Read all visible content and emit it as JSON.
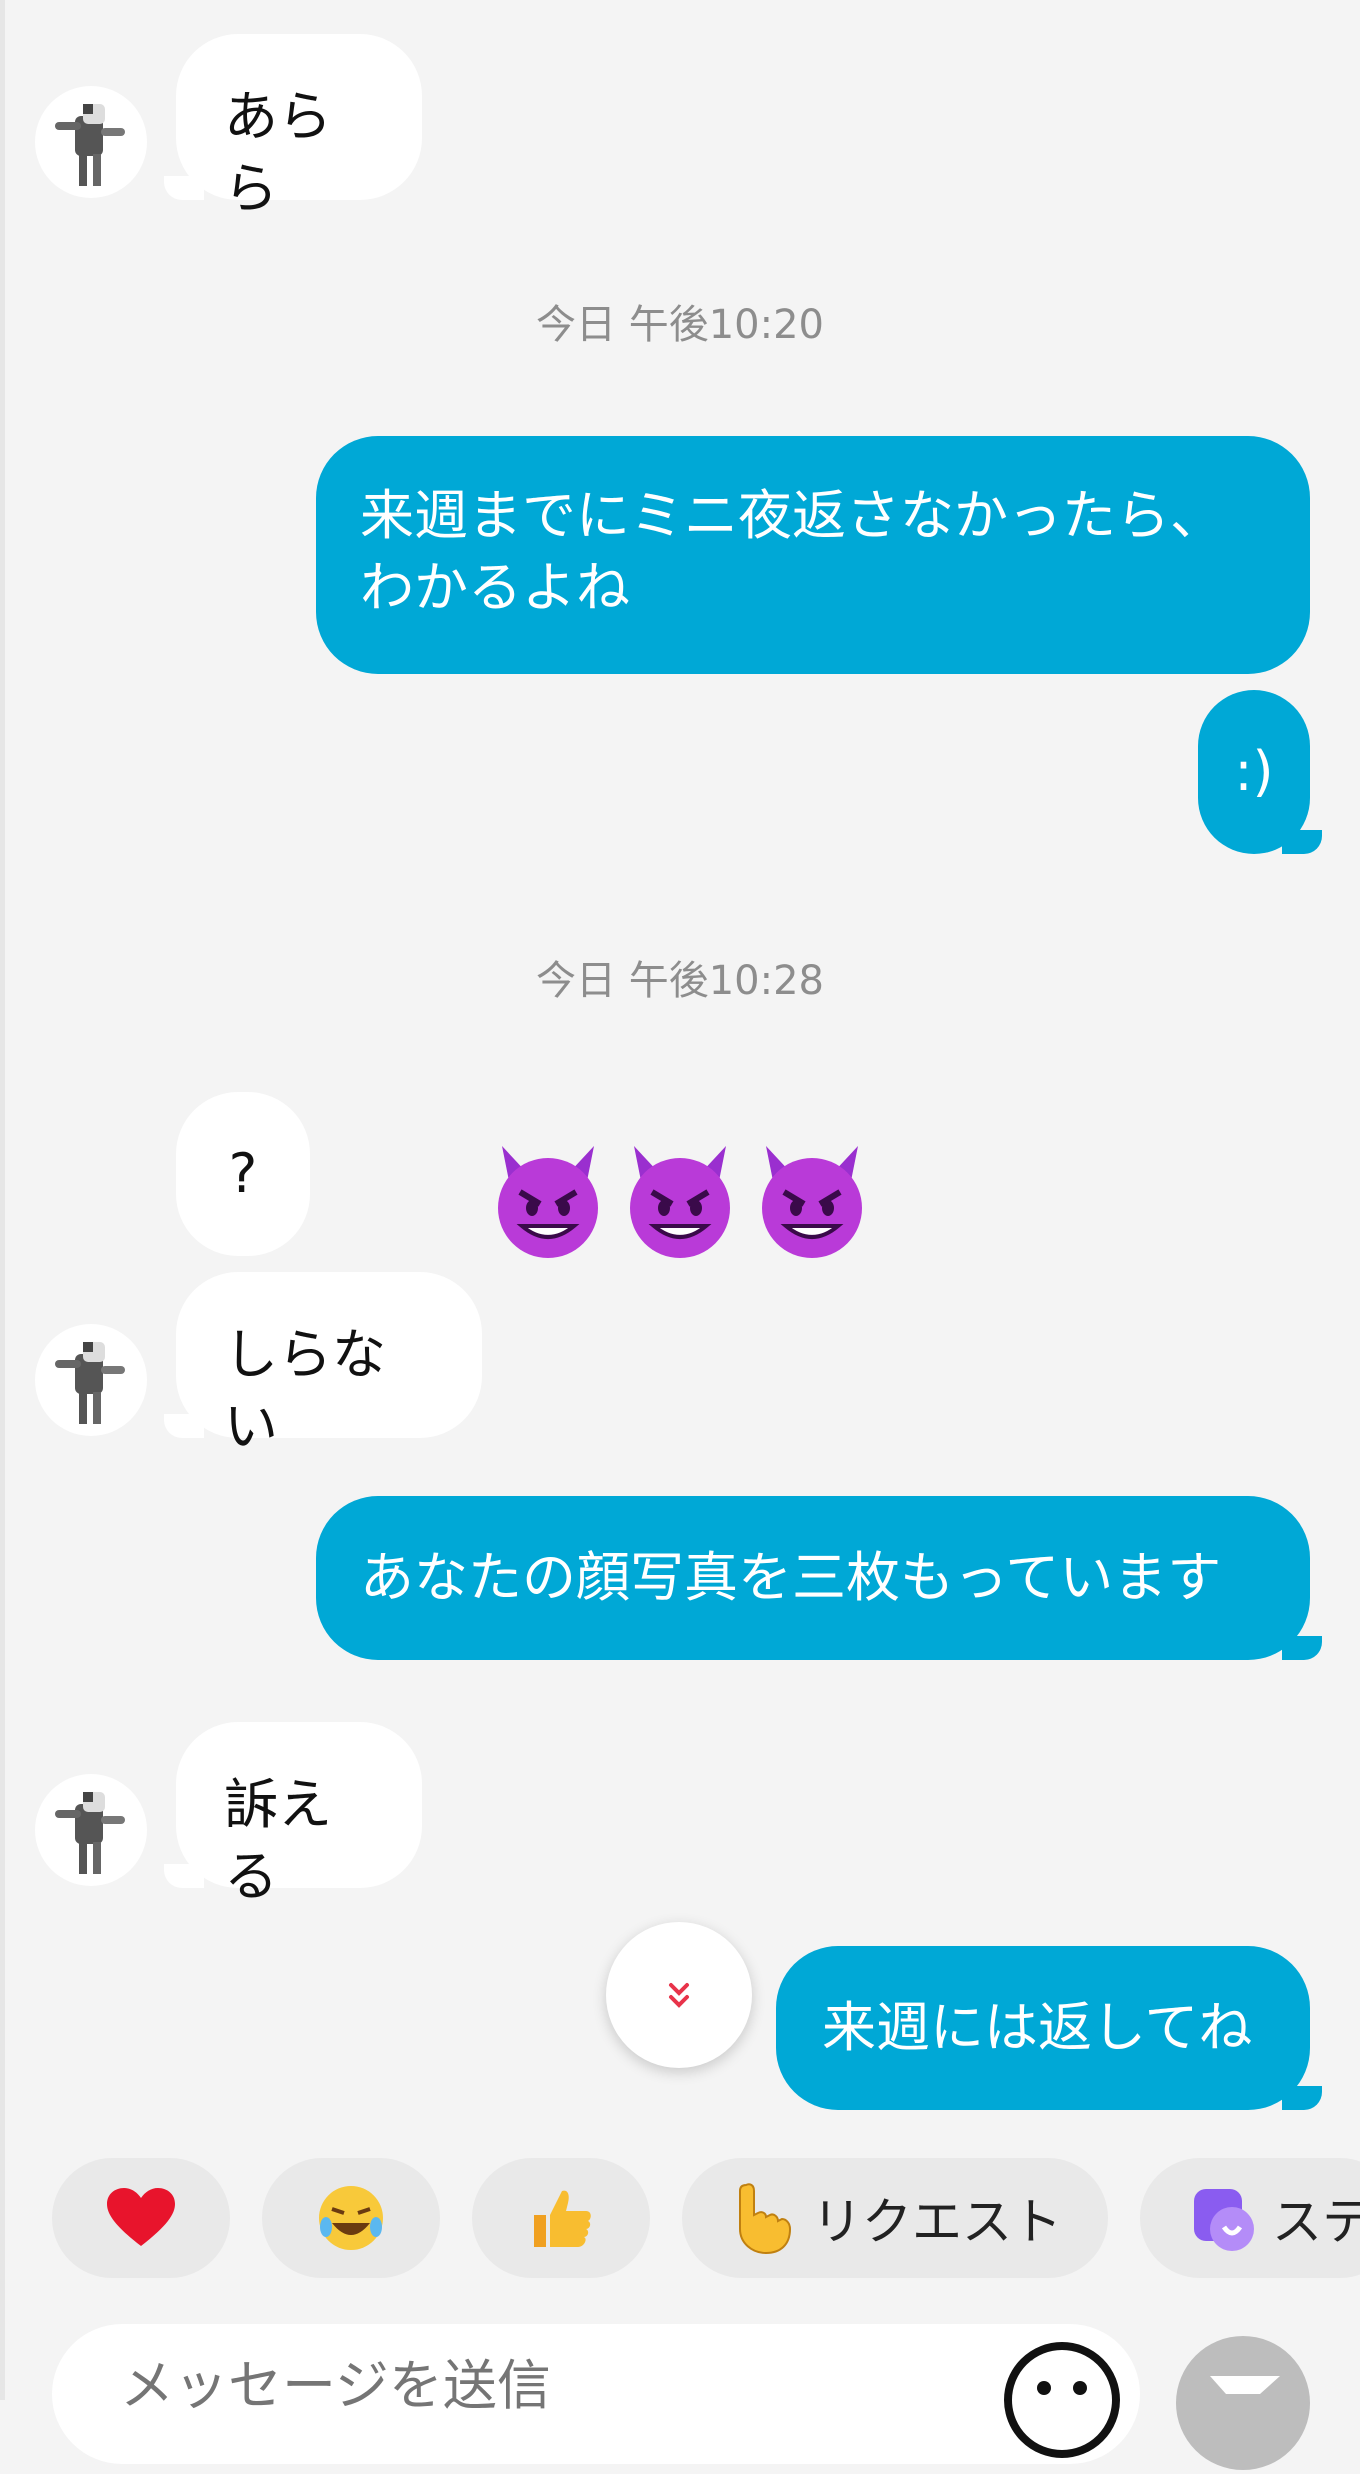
{
  "messages": [
    {
      "id": "m1",
      "text": "あらら"
    },
    {
      "id": "ts1",
      "text": "今日 午後10:20"
    },
    {
      "id": "m2_line1",
      "text": "来週までにミニ夜返さなかったら、"
    },
    {
      "id": "m2_line2",
      "text": "わかるよね"
    },
    {
      "id": "m3",
      "text": ":)"
    },
    {
      "id": "ts2",
      "text": "今日 午後10:28"
    },
    {
      "id": "m4",
      "text": "?"
    },
    {
      "id": "m5",
      "text": "しらない"
    },
    {
      "id": "m6",
      "text": "あなたの顔写真を三枚もっています"
    },
    {
      "id": "m7",
      "text": "訴える"
    },
    {
      "id": "m8",
      "text": "来週には返してね"
    }
  ],
  "quick_replies": {
    "request_label": "リクエスト",
    "sticker_label": "ステ"
  },
  "composer": {
    "placeholder": "メッセージを送信"
  },
  "colors": {
    "outgoing_bubble": "#00a8d6",
    "incoming_bubble": "#ffffff",
    "background": "#f4f4f4"
  },
  "icons": [
    "cat-avatar-icon",
    "devil-emoji-icon",
    "scroll-down-icon",
    "heart-icon",
    "laughing-emoji-icon",
    "thumbs-up-icon",
    "pointing-hand-icon",
    "sticker-icon",
    "smiley-icon",
    "send-icon"
  ]
}
